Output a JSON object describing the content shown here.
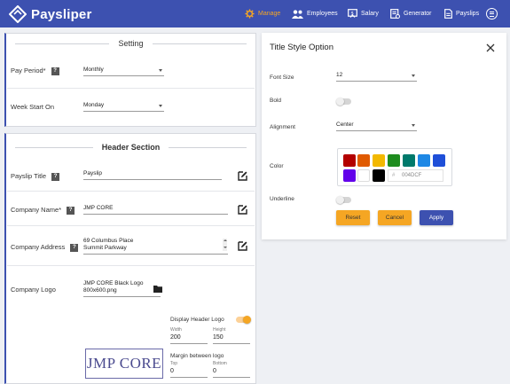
{
  "brand": {
    "name": "Paysliper"
  },
  "nav": {
    "manage": "Manage",
    "employees": "Employees",
    "salary": "Salary",
    "generator": "Generator",
    "payslips": "Payslips"
  },
  "colors": {
    "primary": "#3d51b0",
    "accent": "#f5a623",
    "apply": "#3d51b0"
  },
  "setting": {
    "title": "Setting",
    "pay_period_label": "Pay Period*",
    "pay_period_value": "Monthly",
    "week_start_label": "Week Start On",
    "week_start_value": "Monday",
    "help_glyph": "?"
  },
  "header_section": {
    "title": "Header Section",
    "payslip_title_label": "Payslip Title",
    "payslip_title_value": "Payslip",
    "company_name_label": "Company Name*",
    "company_name_value": "JMP CORE",
    "company_address_label": "Company Address",
    "company_address_line1": "69 Columbus Place",
    "company_address_line2": "Summit Parkway",
    "company_logo_label": "Company Logo",
    "company_logo_file_line1": "JMP CORE Black Logo",
    "company_logo_file_line2": "800x600.png",
    "display_header_logo_label": "Display Header Logo",
    "display_header_logo_on": true,
    "width_label": "Width",
    "width_value": "200",
    "height_label": "Height",
    "height_value": "150",
    "margin_label": "Margin between logo",
    "top_label": "Top",
    "top_value": "0",
    "bottom_label": "Bottom",
    "bottom_value": "0",
    "logo_text": "JMP CORE"
  },
  "title_style": {
    "title": "Title Style Option",
    "font_size_label": "Font Size",
    "font_size_value": "12",
    "bold_label": "Bold",
    "bold_on": false,
    "alignment_label": "Alignment",
    "alignment_value": "Center",
    "color_label": "Color",
    "swatches": [
      "#b30000",
      "#e05a00",
      "#f2b800",
      "#1e8c1e",
      "#00796b",
      "#1e88e5",
      "#1e4fd8",
      "#6200ea",
      "#ffffff",
      "#000000"
    ],
    "hex_prefix": "#",
    "hex_value": "004DCF",
    "underline_label": "Underline",
    "underline_on": false,
    "reset_label": "Reset",
    "cancel_label": "Cancel",
    "apply_label": "Apply"
  }
}
